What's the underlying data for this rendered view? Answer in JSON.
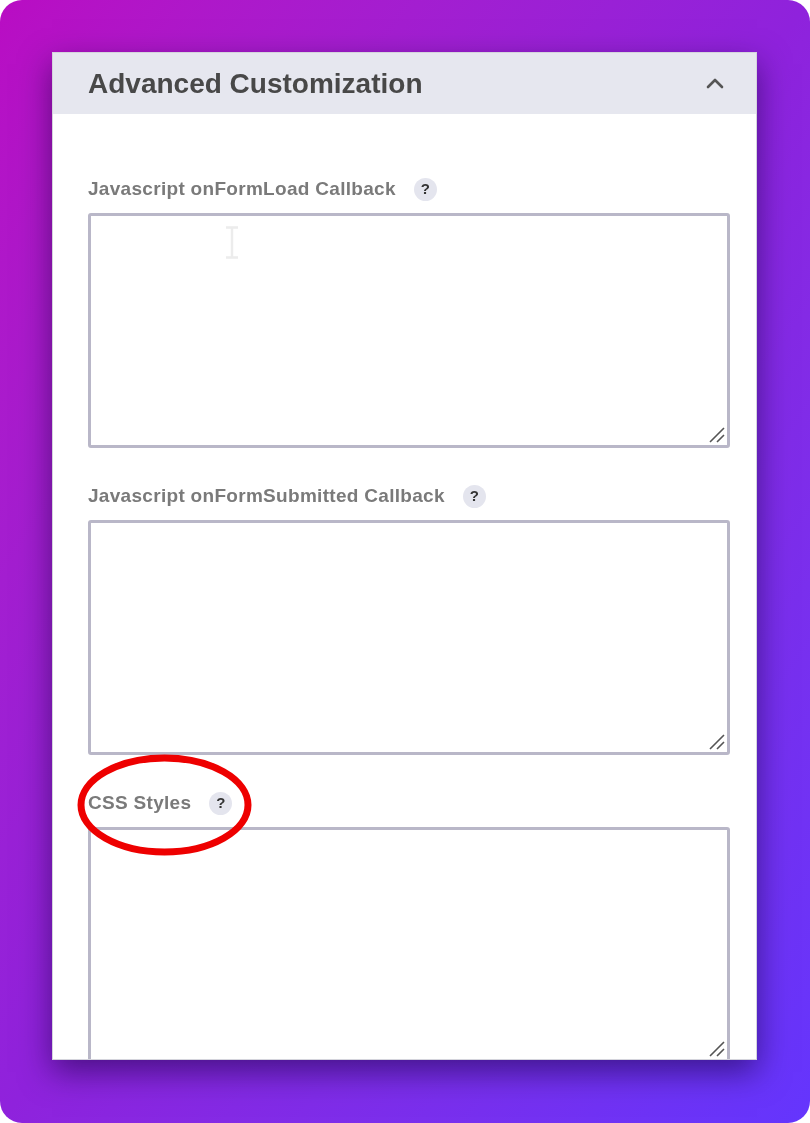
{
  "panel": {
    "title": "Advanced Customization",
    "expanded": true
  },
  "fields": [
    {
      "label": "Javascript onFormLoad Callback",
      "help": "?",
      "highlighted": false,
      "cursor": true
    },
    {
      "label": "Javascript onFormSubmitted Callback",
      "help": "?",
      "highlighted": false,
      "cursor": false
    },
    {
      "label": "CSS Styles",
      "help": "?",
      "highlighted": true,
      "cursor": false
    }
  ]
}
